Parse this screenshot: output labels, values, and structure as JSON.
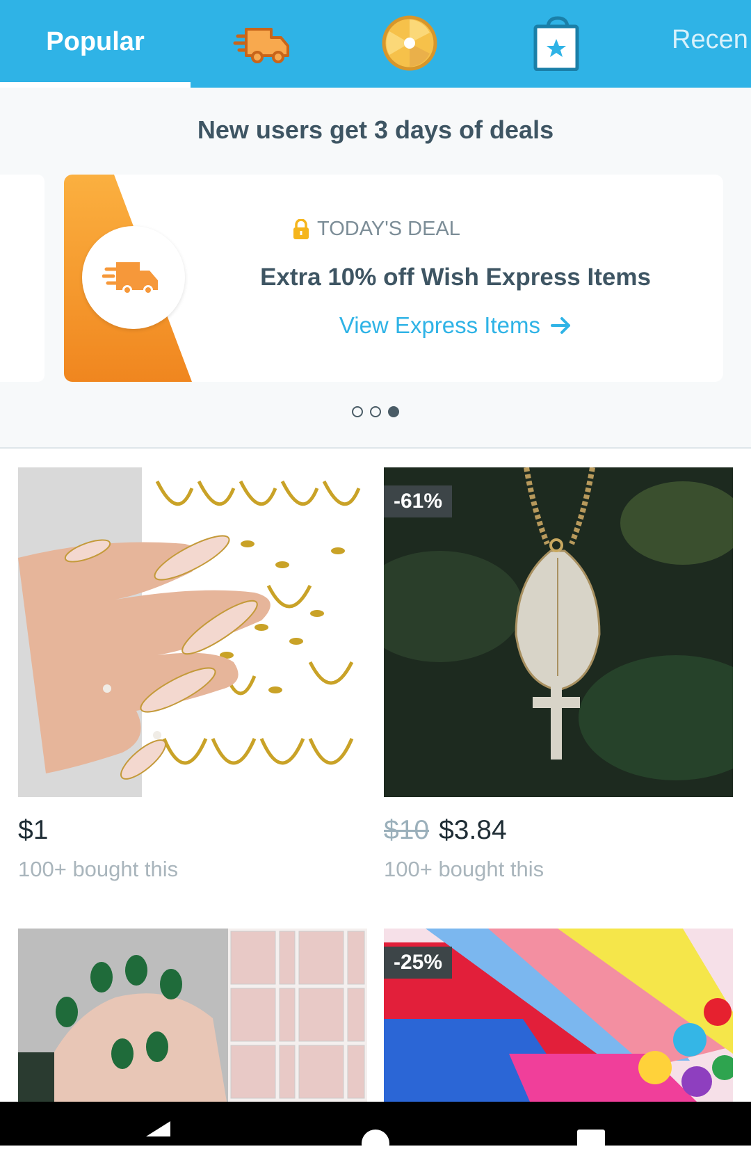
{
  "tabs": {
    "popular_label": "Popular",
    "recent_label": "Recen",
    "icons": [
      "express-truck-icon",
      "wheel-icon",
      "shopping-bag-star-icon"
    ]
  },
  "deals": {
    "title": "New users get 3 days of deals",
    "card": {
      "label": "TODAY'S DEAL",
      "headline": "Extra 10% off Wish Express Items",
      "link": "View Express Items",
      "accent_color": "#f7941d"
    },
    "carousel": {
      "count": 3,
      "active_index": 2
    }
  },
  "products": [
    {
      "price": "$1",
      "bought": "100+ bought this",
      "image": "gold nail stickers"
    },
    {
      "old_price": "$10",
      "price": "$3.84",
      "discount": "-61%",
      "bought": "100+ bought this",
      "image": "praying hands cross pendant necklace"
    },
    {
      "image": "green nail wraps"
    },
    {
      "discount": "-25%",
      "image": "colorful felt fabric rolls"
    }
  ],
  "colors": {
    "brand_blue": "#2fb3e6",
    "text_dark": "#3e5563"
  }
}
